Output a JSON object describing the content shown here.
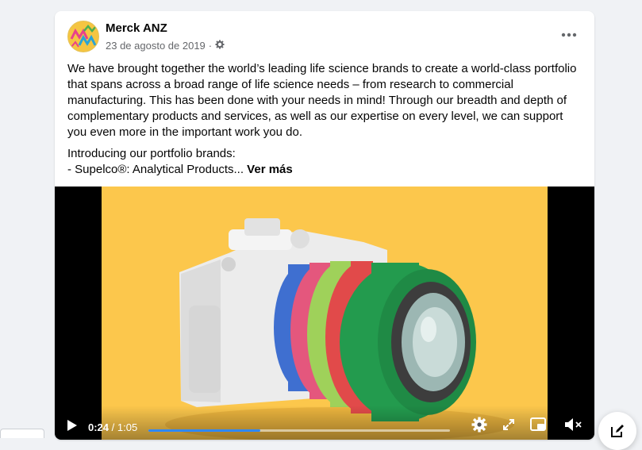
{
  "post": {
    "page_name": "Merck ANZ",
    "date": "23 de agosto de 2019",
    "separator": "·",
    "privacy_icon": "gear-icon",
    "more_icon": "more-options-icon",
    "paragraphs": [
      "We have brought together the world’s leading life science brands to create a world-class portfolio that spans across a broad range of life science needs – from research to commercial manufacturing. This has been done with your needs in mind! Through our breadth and depth of complementary products and services, as well as our expertise on every level, we can support you even more in the important work you do.",
      "Introducing our portfolio brands:"
    ],
    "truncated_line": "- Supelco®: Analytical Products...",
    "see_more_label": "Ver más"
  },
  "video": {
    "current_time": "0:24",
    "time_separator": "/",
    "duration": "1:05",
    "progress_fraction": 0.37,
    "accent_color": "#2d88ff",
    "background_color": "#fcc74c",
    "icons": {
      "play": "play-icon",
      "settings": "settings-icon",
      "fullscreen": "fullscreen-icon",
      "pip": "picture-in-picture-icon",
      "mute": "muted-speaker-icon"
    }
  },
  "compose": {
    "icon": "compose-icon"
  }
}
